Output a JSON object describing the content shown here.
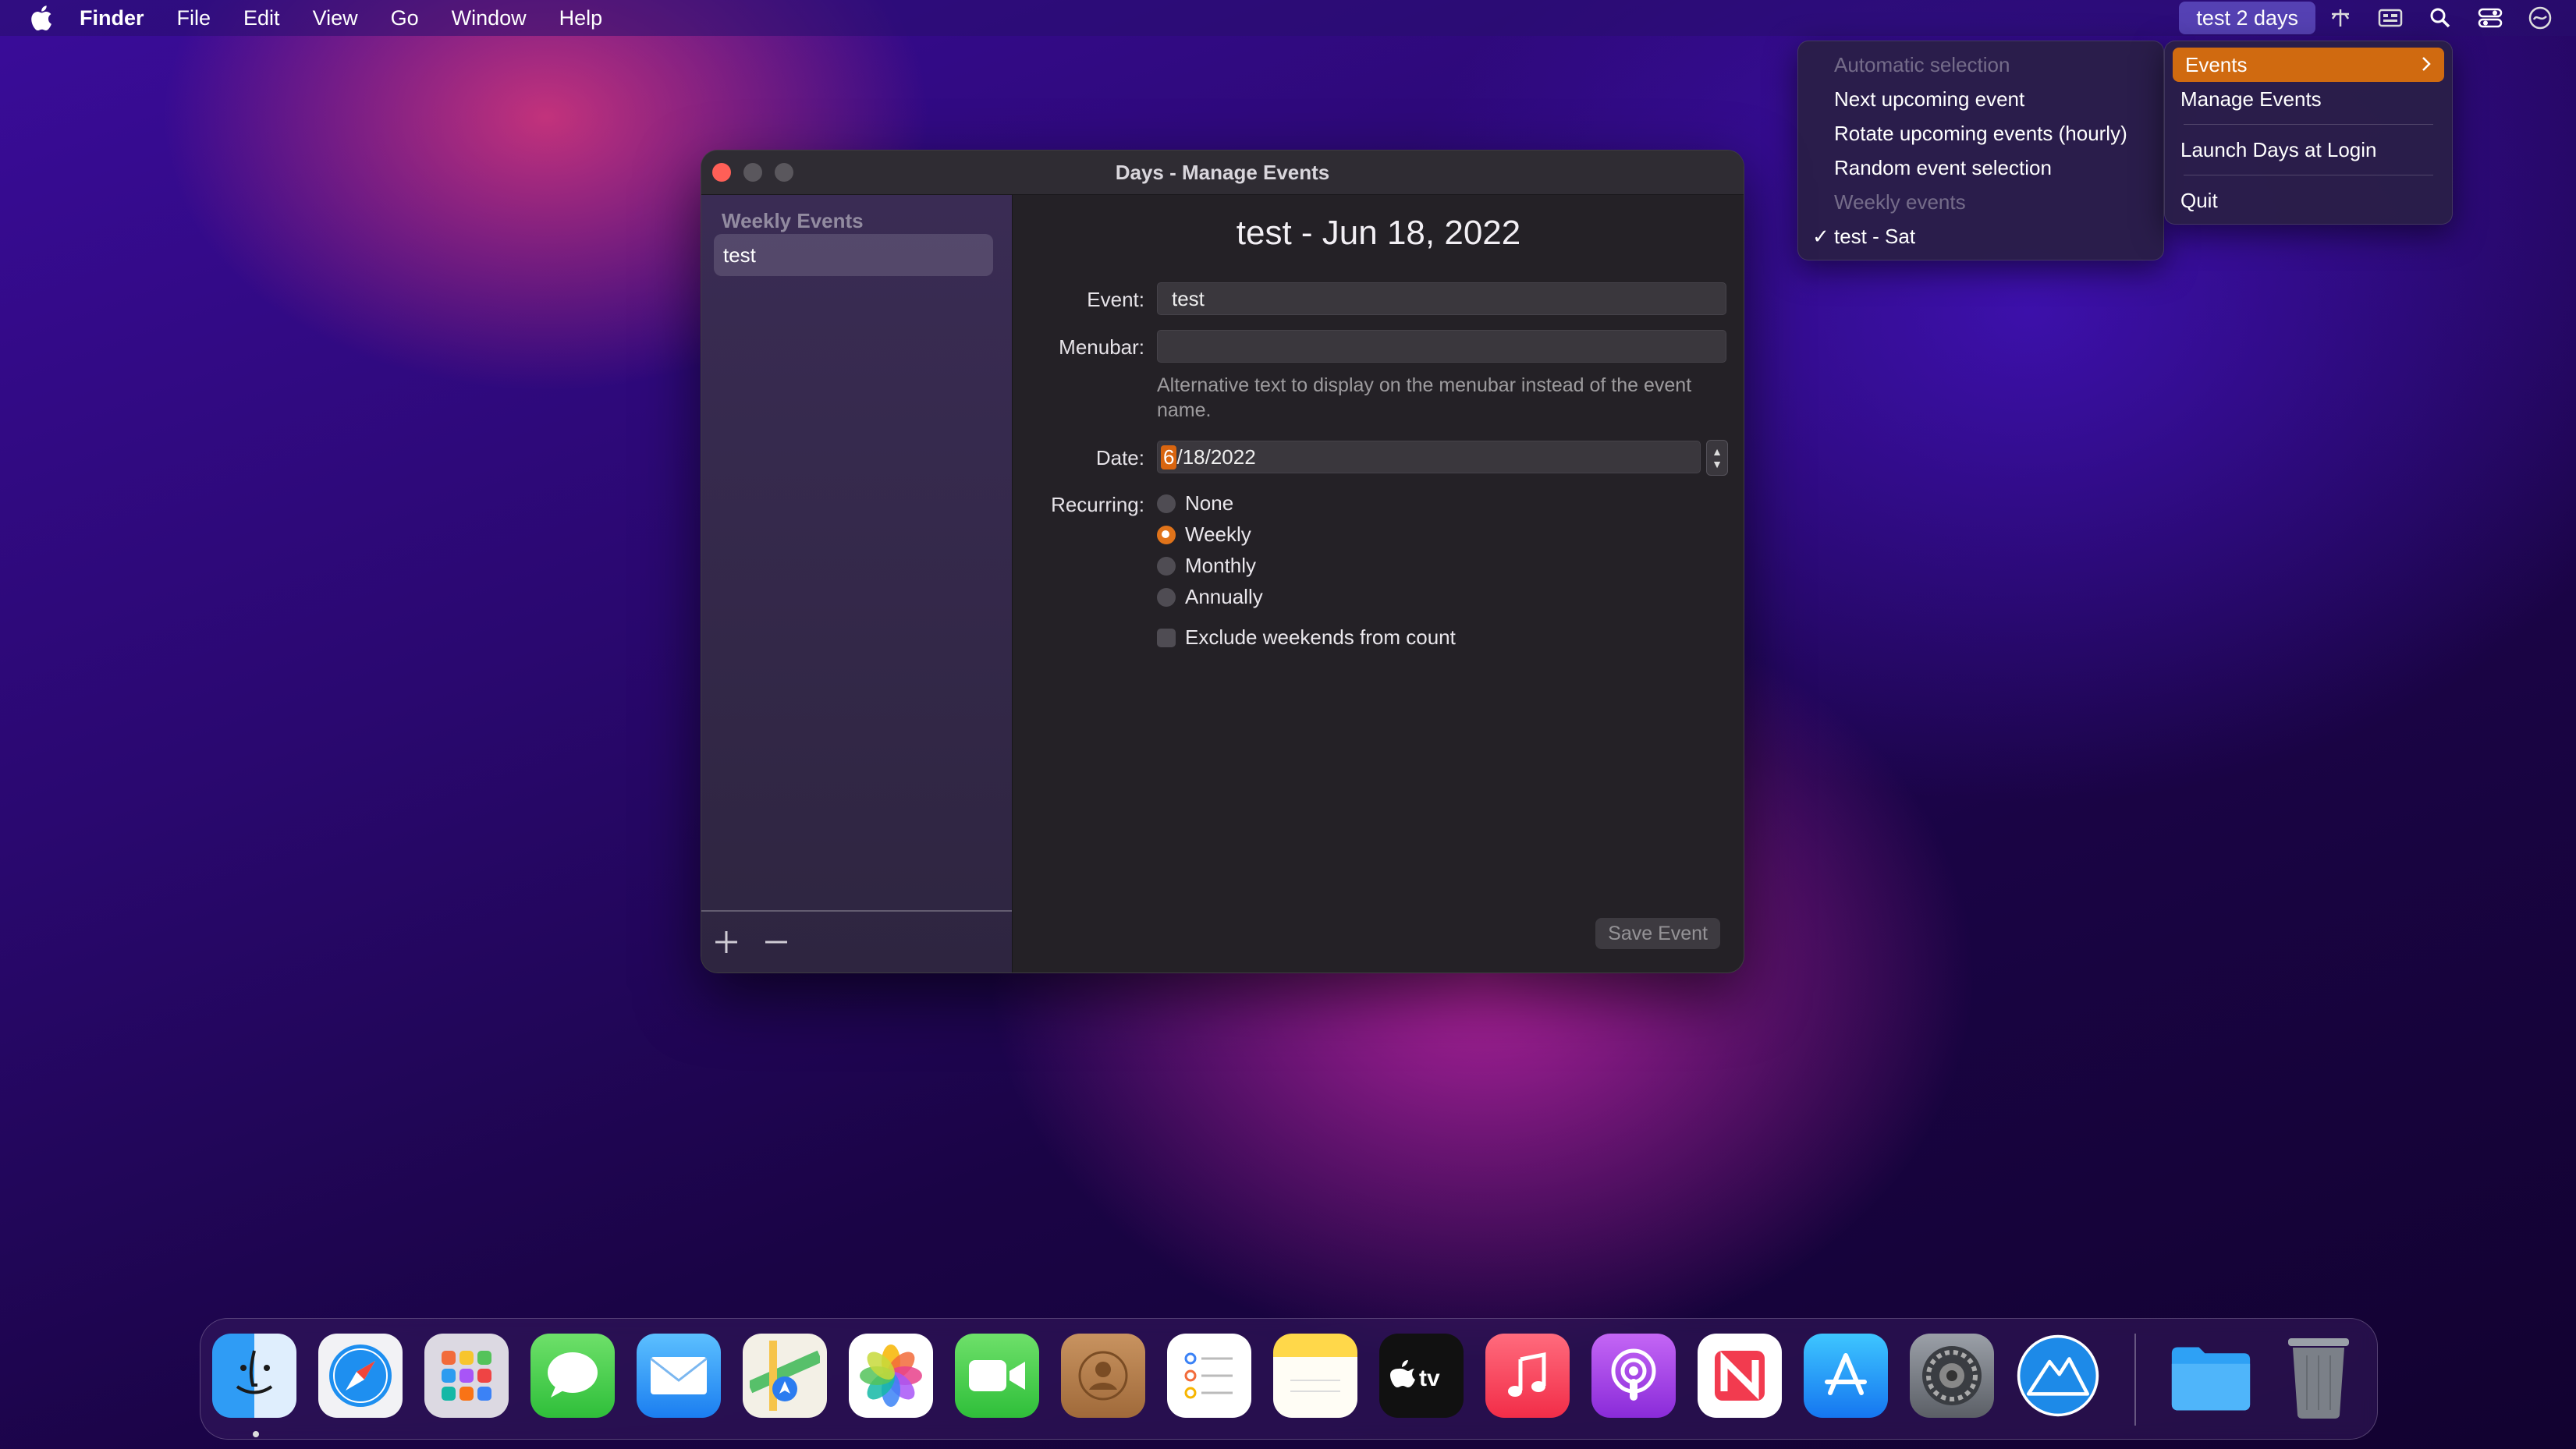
{
  "menubar": {
    "app_name": "Finder",
    "items": [
      "File",
      "Edit",
      "View",
      "Go",
      "Window",
      "Help"
    ],
    "status_label": "test 2 days"
  },
  "left_menu": {
    "items": [
      {
        "label": "Automatic selection",
        "disabled": true
      },
      {
        "label": "Next upcoming event"
      },
      {
        "label": "Rotate upcoming events (hourly)"
      },
      {
        "label": "Random event selection"
      },
      {
        "label": "Weekly events",
        "disabled": true
      },
      {
        "label": "test - Sat",
        "checked": true
      }
    ]
  },
  "right_menu": {
    "events": "Events",
    "manage": "Manage Events",
    "launch": "Launch Days at Login",
    "quit": "Quit"
  },
  "window": {
    "title": "Days - Manage Events",
    "sidebar": {
      "header": "Weekly Events",
      "item": "test"
    },
    "heading": "test - Jun 18, 2022",
    "labels": {
      "event": "Event:",
      "menubar": "Menubar:",
      "date": "Date:",
      "recurring": "Recurring:"
    },
    "event_value": "test",
    "menubar_value": "",
    "hint": "Alternative text to display on the menubar instead of the event name.",
    "date": {
      "month": "6",
      "rest": "/18/2022"
    },
    "recurring_options": [
      "None",
      "Weekly",
      "Monthly",
      "Annually"
    ],
    "recurring_selected": "Weekly",
    "exclude_weekends": "Exclude weekends from count",
    "save_button": "Save Event"
  },
  "dock": {
    "apps": [
      "Finder",
      "Safari",
      "Launchpad",
      "Messages",
      "Mail",
      "Maps",
      "Photos",
      "FaceTime",
      "Contacts",
      "Reminders",
      "Notes",
      "TV",
      "Music",
      "Podcasts",
      "News",
      "App Store",
      "System Preferences",
      "Days",
      "Downloads",
      "Trash"
    ]
  },
  "colors": {
    "accent": "#d9650f",
    "close": "#ff5f57"
  }
}
